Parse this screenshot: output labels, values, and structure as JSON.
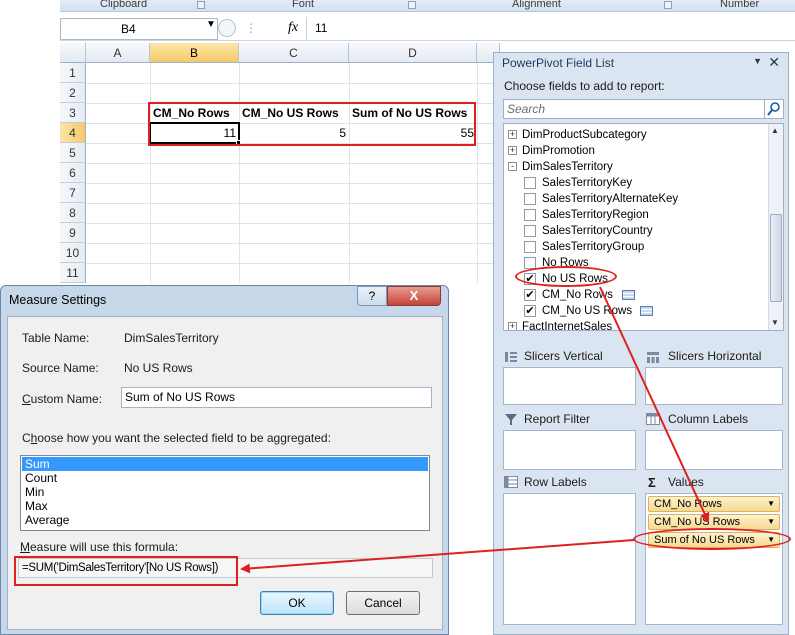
{
  "ribbon": {
    "groups": [
      "Clipboard",
      "Font",
      "Alignment",
      "Number"
    ]
  },
  "formula_bar": {
    "name_box": "B4",
    "fx_label": "fx",
    "value": "11"
  },
  "sheet": {
    "columns": [
      "A",
      "B",
      "C",
      "D"
    ],
    "rows": [
      "1",
      "2",
      "3",
      "4",
      "5",
      "6",
      "7",
      "8",
      "9",
      "10",
      "11"
    ],
    "headers": {
      "B3": "CM_No Rows",
      "C3": "CM_No US Rows",
      "D3": "Sum of No US Rows"
    },
    "values": {
      "B4": "11",
      "C4": "5",
      "D4": "55"
    },
    "active_cell": "B4"
  },
  "field_list": {
    "title": "PowerPivot Field List",
    "choose_label": "Choose fields to add to report:",
    "search_placeholder": "Search",
    "items": [
      {
        "label": "DimProductSubcategory",
        "type": "table",
        "expander": "+"
      },
      {
        "label": "DimPromotion",
        "type": "table",
        "expander": "+"
      },
      {
        "label": "DimSalesTerritory",
        "type": "table",
        "expander": "-"
      },
      {
        "label": "SalesTerritoryKey",
        "type": "field",
        "checked": false
      },
      {
        "label": "SalesTerritoryAlternateKey",
        "type": "field",
        "checked": false
      },
      {
        "label": "SalesTerritoryRegion",
        "type": "field",
        "checked": false
      },
      {
        "label": "SalesTerritoryCountry",
        "type": "field",
        "checked": false
      },
      {
        "label": "SalesTerritoryGroup",
        "type": "field",
        "checked": false
      },
      {
        "label": "No Rows",
        "type": "field",
        "checked": false
      },
      {
        "label": "No US Rows",
        "type": "field",
        "checked": true
      },
      {
        "label": "CM_No Rows",
        "type": "measure",
        "checked": true
      },
      {
        "label": "CM_No US Rows",
        "type": "measure",
        "checked": true
      },
      {
        "label": "FactInternetSales",
        "type": "table",
        "expander": "+"
      }
    ],
    "zones": {
      "slicers_vertical": "Slicers Vertical",
      "slicers_horizontal": "Slicers Horizontal",
      "report_filter": "Report Filter",
      "column_labels": "Column Labels",
      "row_labels": "Row Labels",
      "values": "Values"
    },
    "values_items": [
      "CM_No Rows",
      "CM_No US Rows",
      "Sum of No US Rows"
    ]
  },
  "dialog": {
    "title": "Measure Settings",
    "help_glyph": "?",
    "close_glyph": "X",
    "table_name_label": "Table Name:",
    "table_name": "DimSalesTerritory",
    "source_name_label": "Source Name:",
    "source_name": "No US Rows",
    "custom_name_label_u": "C",
    "custom_name_label_rest": "ustom Name:",
    "custom_name": "Sum of No US Rows",
    "aggregate_label_pre": "C",
    "aggregate_label_u": "h",
    "aggregate_label_rest": "oose how you want the selected field to be aggregated:",
    "aggregations": [
      "Sum",
      "Count",
      "Min",
      "Max",
      "Average"
    ],
    "selected_aggregation": "Sum",
    "formula_label_u": "M",
    "formula_label_rest": "easure will use this formula:",
    "formula": "=SUM('DimSalesTerritory'[No US Rows])",
    "ok_label": "OK",
    "cancel_label": "Cancel"
  },
  "annotation_color": "#e02020",
  "accent_color": "#3399ff"
}
